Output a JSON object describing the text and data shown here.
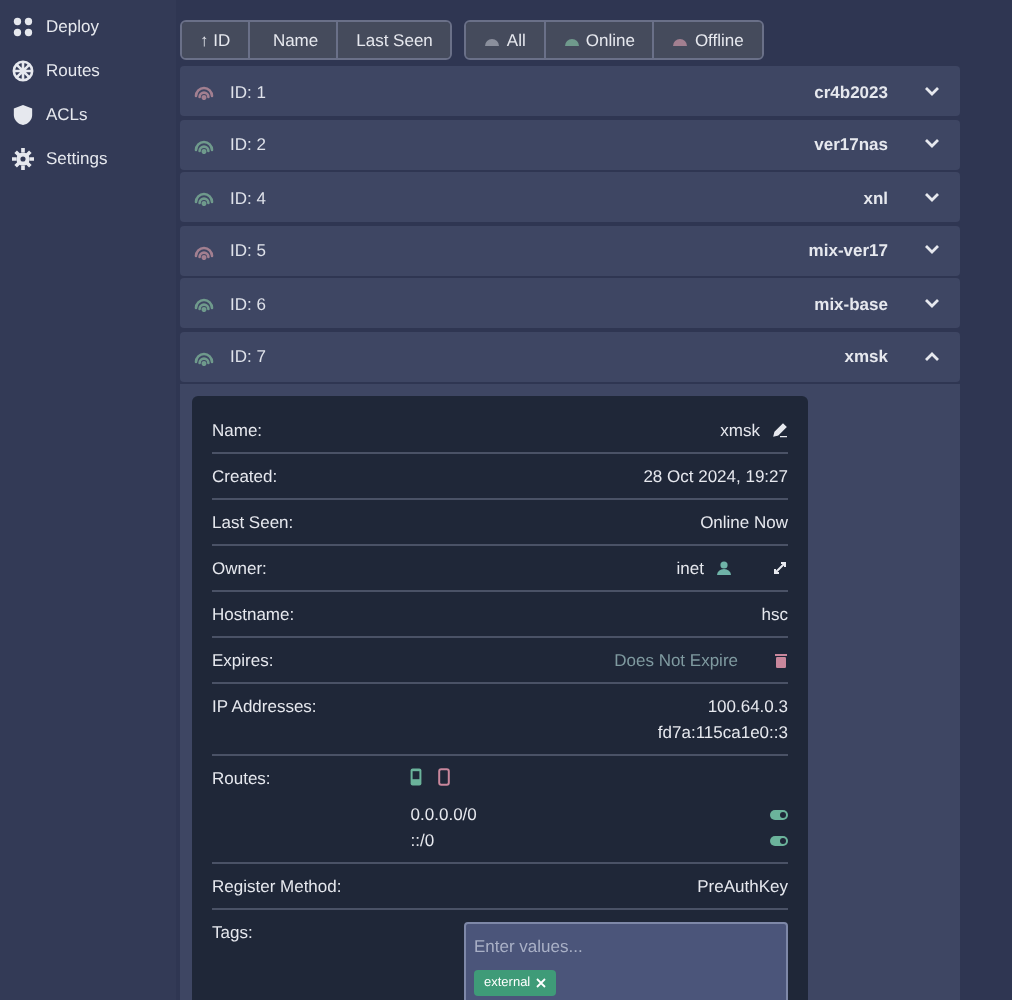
{
  "sidebar": {
    "items": [
      {
        "label": "Deploy",
        "kind": "deploy"
      },
      {
        "label": "Routes",
        "kind": "routes"
      },
      {
        "label": "ACLs",
        "kind": "acls"
      },
      {
        "label": "Settings",
        "kind": "settings"
      }
    ]
  },
  "sort": [
    {
      "label": "ID",
      "arrow": "↑"
    },
    {
      "label": "Name"
    },
    {
      "label": "Last Seen"
    }
  ],
  "filters": [
    {
      "label": "All",
      "color": "#8a8f9c"
    },
    {
      "label": "Online",
      "color": "#6f9a8c"
    },
    {
      "label": "Offline",
      "color": "#a27f90"
    }
  ],
  "nodes": [
    {
      "id": "ID: 1",
      "name": "cr4b2023",
      "online": false,
      "expanded": false
    },
    {
      "id": "ID: 2",
      "name": "ver17nas",
      "online": true,
      "expanded": false
    },
    {
      "id": "ID: 4",
      "name": "xnl",
      "online": true,
      "expanded": false
    },
    {
      "id": "ID: 5",
      "name": "mix-ver17",
      "online": false,
      "expanded": false
    },
    {
      "id": "ID: 6",
      "name": "mix-base",
      "online": true,
      "expanded": false
    },
    {
      "id": "ID: 7",
      "name": "xmsk",
      "online": true,
      "expanded": true
    }
  ],
  "details": [
    {
      "kind": "editable",
      "label": "Name:",
      "value": "xmsk"
    },
    {
      "kind": "text",
      "label": "Created:",
      "value": "28 Oct 2024, 19:27"
    },
    {
      "kind": "text",
      "label": "Last Seen:",
      "value": "Online Now"
    },
    {
      "kind": "owner",
      "label": "Owner:",
      "value": "inet"
    },
    {
      "kind": "text",
      "label": "Hostname:",
      "value": "hsc"
    },
    {
      "kind": "expires",
      "label": "Expires:",
      "value": "Does Not Expire"
    },
    {
      "kind": "multi",
      "label": "IP Addresses:",
      "values": [
        "100.64.0.3",
        "fd7a:115ca1e0::3"
      ]
    },
    {
      "kind": "routes",
      "label": "Routes:",
      "routes": [
        {
          "prefix": "0.0.0.0/0",
          "enabled": true
        },
        {
          "prefix": "::/0",
          "enabled": true
        }
      ]
    },
    {
      "kind": "text",
      "label": "Register Method:",
      "value": "PreAuthKey"
    },
    {
      "kind": "tags",
      "label": "Tags:",
      "placeholder": "Enter values...",
      "tags": [
        "external"
      ]
    }
  ]
}
